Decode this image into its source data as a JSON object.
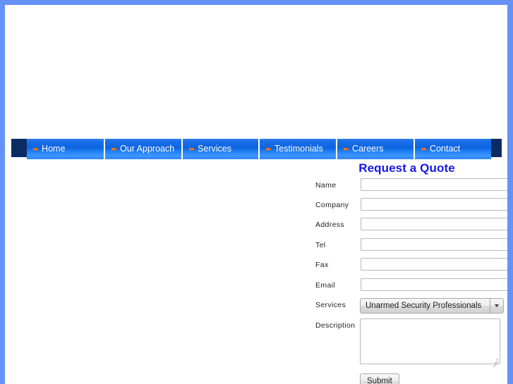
{
  "theme": {
    "frame_border_color": "#6691f5",
    "nav_cap_color": "#0b2c63",
    "nav_tab_blue": "#0d63e0",
    "nav_bullet_orange": "#ff7a18",
    "title_color": "#1717ee",
    "page_background": "#ffffff"
  },
  "nav": {
    "bullet_glyph": "▸▸",
    "items": [
      {
        "label": "Home",
        "icon": "double-arrow-icon"
      },
      {
        "label": "Our Approach",
        "icon": "double-arrow-icon"
      },
      {
        "label": "Services",
        "icon": "double-arrow-icon"
      },
      {
        "label": "Testimonials",
        "icon": "double-arrow-icon"
      },
      {
        "label": "Careers",
        "icon": "double-arrow-icon"
      },
      {
        "label": "Contact",
        "icon": "double-arrow-icon"
      }
    ]
  },
  "form": {
    "title": "Request a Quote",
    "fields": {
      "name": {
        "label": "Name",
        "value": "",
        "placeholder": ""
      },
      "company": {
        "label": "Company",
        "value": "",
        "placeholder": ""
      },
      "address": {
        "label": "Address",
        "value": "",
        "placeholder": ""
      },
      "tel": {
        "label": "Tel",
        "value": "",
        "placeholder": ""
      },
      "fax": {
        "label": "Fax",
        "value": "",
        "placeholder": ""
      },
      "email": {
        "label": "Email",
        "value": "",
        "placeholder": ""
      },
      "services": {
        "label": "Services",
        "selected": "Unarmed Security Professionals"
      },
      "description": {
        "label": "Description",
        "value": "",
        "placeholder": ""
      }
    },
    "submit": {
      "label": "Submit"
    },
    "dropdown_icon": "chevron-down-icon"
  }
}
